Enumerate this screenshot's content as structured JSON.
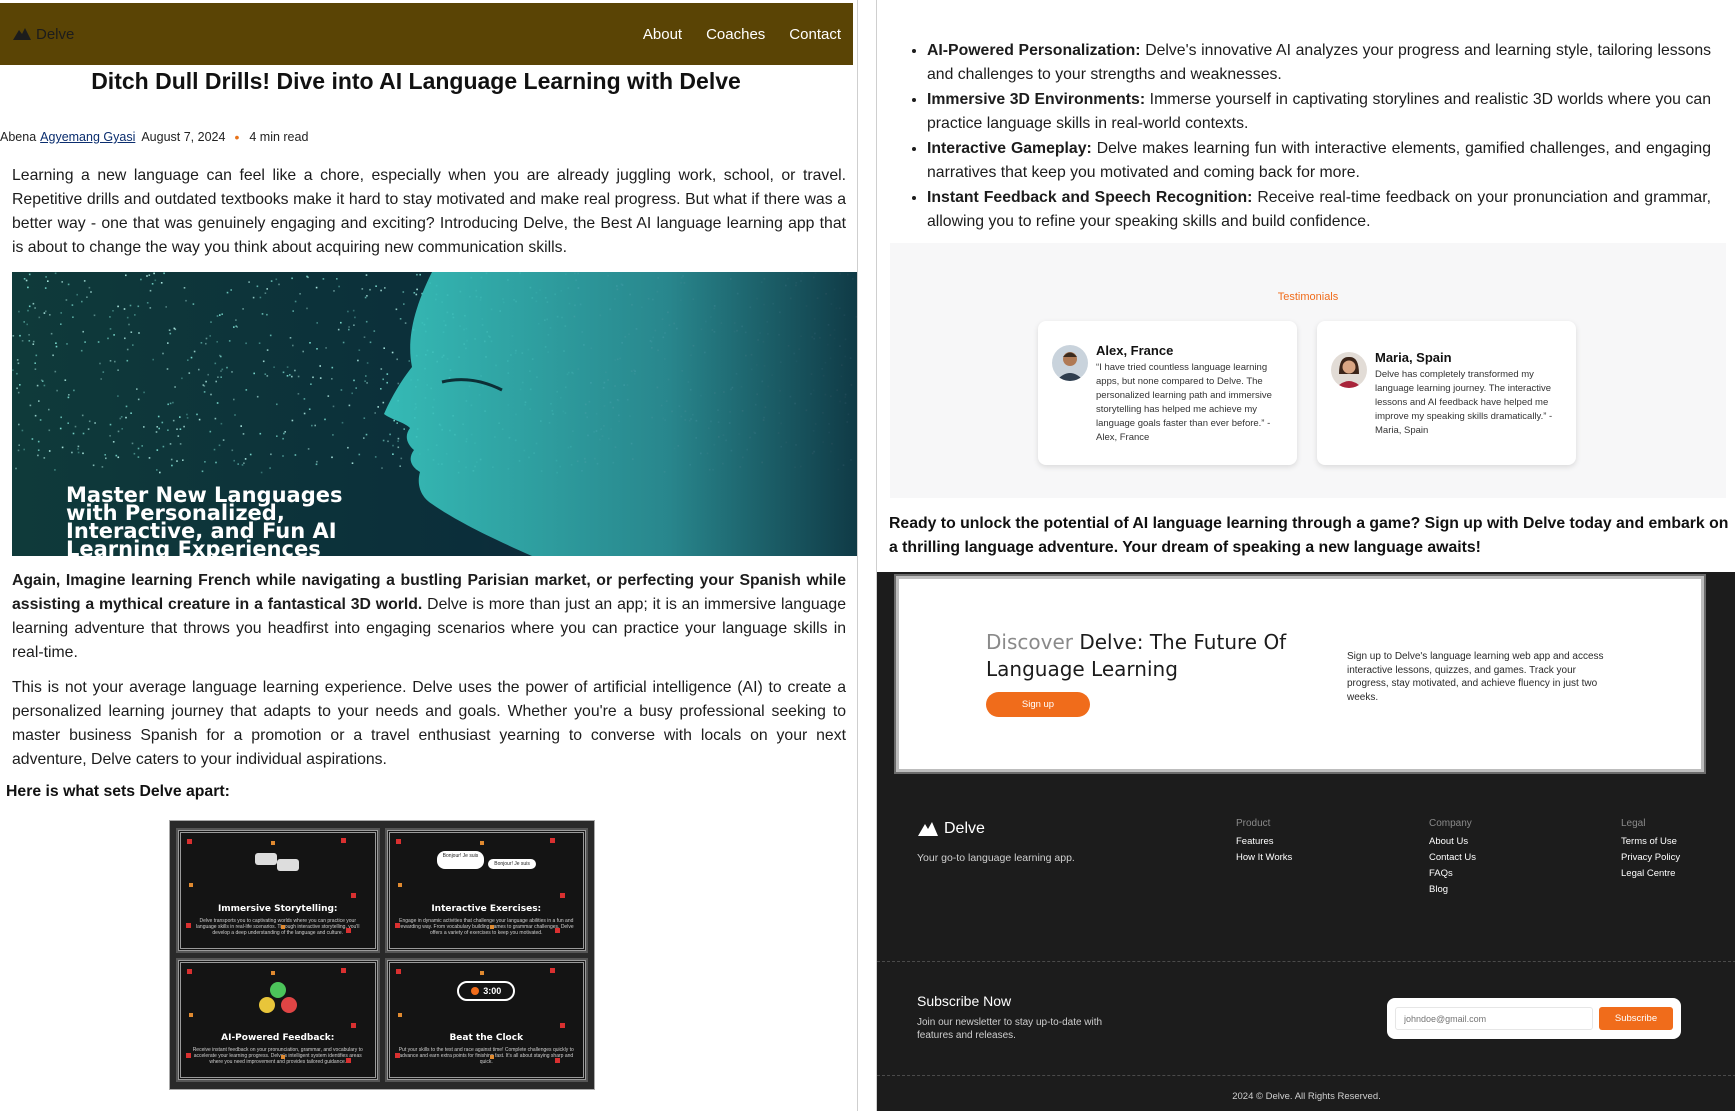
{
  "nav": {
    "logo": "Delve",
    "links": [
      "About",
      "Coaches",
      "Contact"
    ]
  },
  "article": {
    "title": "Ditch Dull Drills! Dive into AI Language Learning with Delve",
    "author_first": "Abena",
    "author_rest": "Agyemang Gyasi",
    "date": "August 7, 2024",
    "read_time": "4 min read",
    "intro": "Learning a new language can feel like a chore, especially when you are already juggling work, school, or travel. Repetitive drills and outdated textbooks make it hard to stay motivated and make real progress. But what if there was a better way - one that was genuinely engaging and exciting? Introducing Delve, the Best AI language learning app that is about to change the way you think about acquiring new communication skills.",
    "hero_text": "Master New Languages with Personalized, Interactive, and Fun AI Learning Experiences",
    "para2_bold": " Again, Imagine learning French while navigating a bustling Parisian market, or perfecting your Spanish while assisting a mythical creature in a fantastical 3D world.",
    "para2_rest": " Delve is more than just an app; it is an immersive language learning adventure that throws you headfirst into engaging scenarios where you can practice your language skills in real-time.",
    "para3": "This is not your average language learning experience. Delve uses the power of artificial intelligence (AI) to create a personalized learning journey that adapts to your needs and goals. Whether you're a busy professional seeking to master business Spanish for a promotion or a travel enthusiast yearning to converse with locals on your next adventure, Delve caters to your individual aspirations.",
    "apart_heading": "Here is what sets Delve apart:",
    "feature_cards": [
      {
        "title": "Immersive Storytelling:",
        "desc": "Delve transports you to captivating worlds where you can practice your language skills in real-life scenarios. Through interactive storytelling, you'll develop a deep understanding of the language and culture."
      },
      {
        "title": "Interactive Exercises:",
        "desc": "Engage in dynamic activities that challenge your language abilities in a fun and rewarding way. From vocabulary building games to grammar challenges, Delve offers a variety of exercises to keep you motivated."
      },
      {
        "title": "AI-Powered Feedback:",
        "desc": "Receive instant feedback on your pronunciation, grammar, and vocabulary to accelerate your learning progress. Delve's intelligent system identifies areas where you need improvement and provides tailored guidance."
      },
      {
        "title": "Beat the Clock",
        "desc": "Put your skills to the test and race against time! Complete challenges quickly to advance and earn extra points for finishing fast. It's all about staying sharp and quick."
      }
    ],
    "bubbles": [
      "Bonjour! Je suis",
      "Bonjour! Je suis"
    ],
    "timer": "3:00"
  },
  "bullets": [
    {
      "bold": "AI-Powered Personalization:",
      "text": " Delve's innovative AI analyzes your progress and learning style, tailoring lessons and challenges to your strengths and weaknesses."
    },
    {
      "bold": "Immersive 3D Environments:",
      "text": " Immerse yourself in captivating storylines and realistic 3D worlds where you can practice language skills in real-world contexts."
    },
    {
      "bold": "Interactive Gameplay:",
      "text": " Delve makes learning fun with interactive elements, gamified challenges, and engaging narratives that keep you motivated and coming back for more."
    },
    {
      "bold": "Instant Feedback and Speech Recognition:",
      "text": " Receive real-time feedback on your pronunciation and grammar, allowing you to refine your speaking skills and build confidence."
    }
  ],
  "testimonials": {
    "heading": "Testimonials",
    "items": [
      {
        "name": "Alex, France",
        "quote": "“I have tried countless language learning apps, but none compared to Delve. The personalized learning path and immersive storytelling has helped me achieve my language goals faster than ever before.” - Alex, France"
      },
      {
        "name": "Maria, Spain",
        "quote": "Delve has completely transformed my language learning journey. The interactive lessons and AI feedback have helped me improve my speaking skills dramatically.” - Maria, Spain"
      }
    ]
  },
  "cta": "Ready to unlock the potential of AI language learning through a game? Sign up with Delve today and embark on a thrilling language adventure. Your dream of speaking a new language awaits!",
  "banner": {
    "title_gray": "Discover",
    "title_rest": " Delve: The Future Of",
    "title_line2": "Language Learning",
    "button": "Sign up",
    "desc": "Sign up to  Delve's language learning web app and access interactive lessons, quizzes, and games. Track your progress, stay motivated, and achieve fluency in just two weeks."
  },
  "footer": {
    "logo": "Delve",
    "tagline": "Your go-to language learning app.",
    "columns": [
      {
        "heading": "Product",
        "items": [
          "Features",
          "How It Works"
        ]
      },
      {
        "heading": "Company",
        "items": [
          "About Us",
          "Contact Us",
          "FAQs",
          "Blog"
        ]
      },
      {
        "heading": "Legal",
        "items": [
          "Terms of Use",
          "Privacy Policy",
          "Legal Centre"
        ]
      }
    ],
    "subscribe_title": "Subscribe Now",
    "subscribe_desc": "Join our newsletter to stay up-to-date with features and releases.",
    "email_placeholder": "johndoe@gmail.com",
    "subscribe_button": "Subscribe",
    "copyright": "2024 © Delve. All Rights Reserved."
  },
  "colors": {
    "nav_bg": "#5a4405",
    "accent_orange": "#f06c1b",
    "footer_bg": "#1c1c1c"
  },
  "icons": [
    "delve-logo-icon",
    "user-avatar-icon"
  ]
}
